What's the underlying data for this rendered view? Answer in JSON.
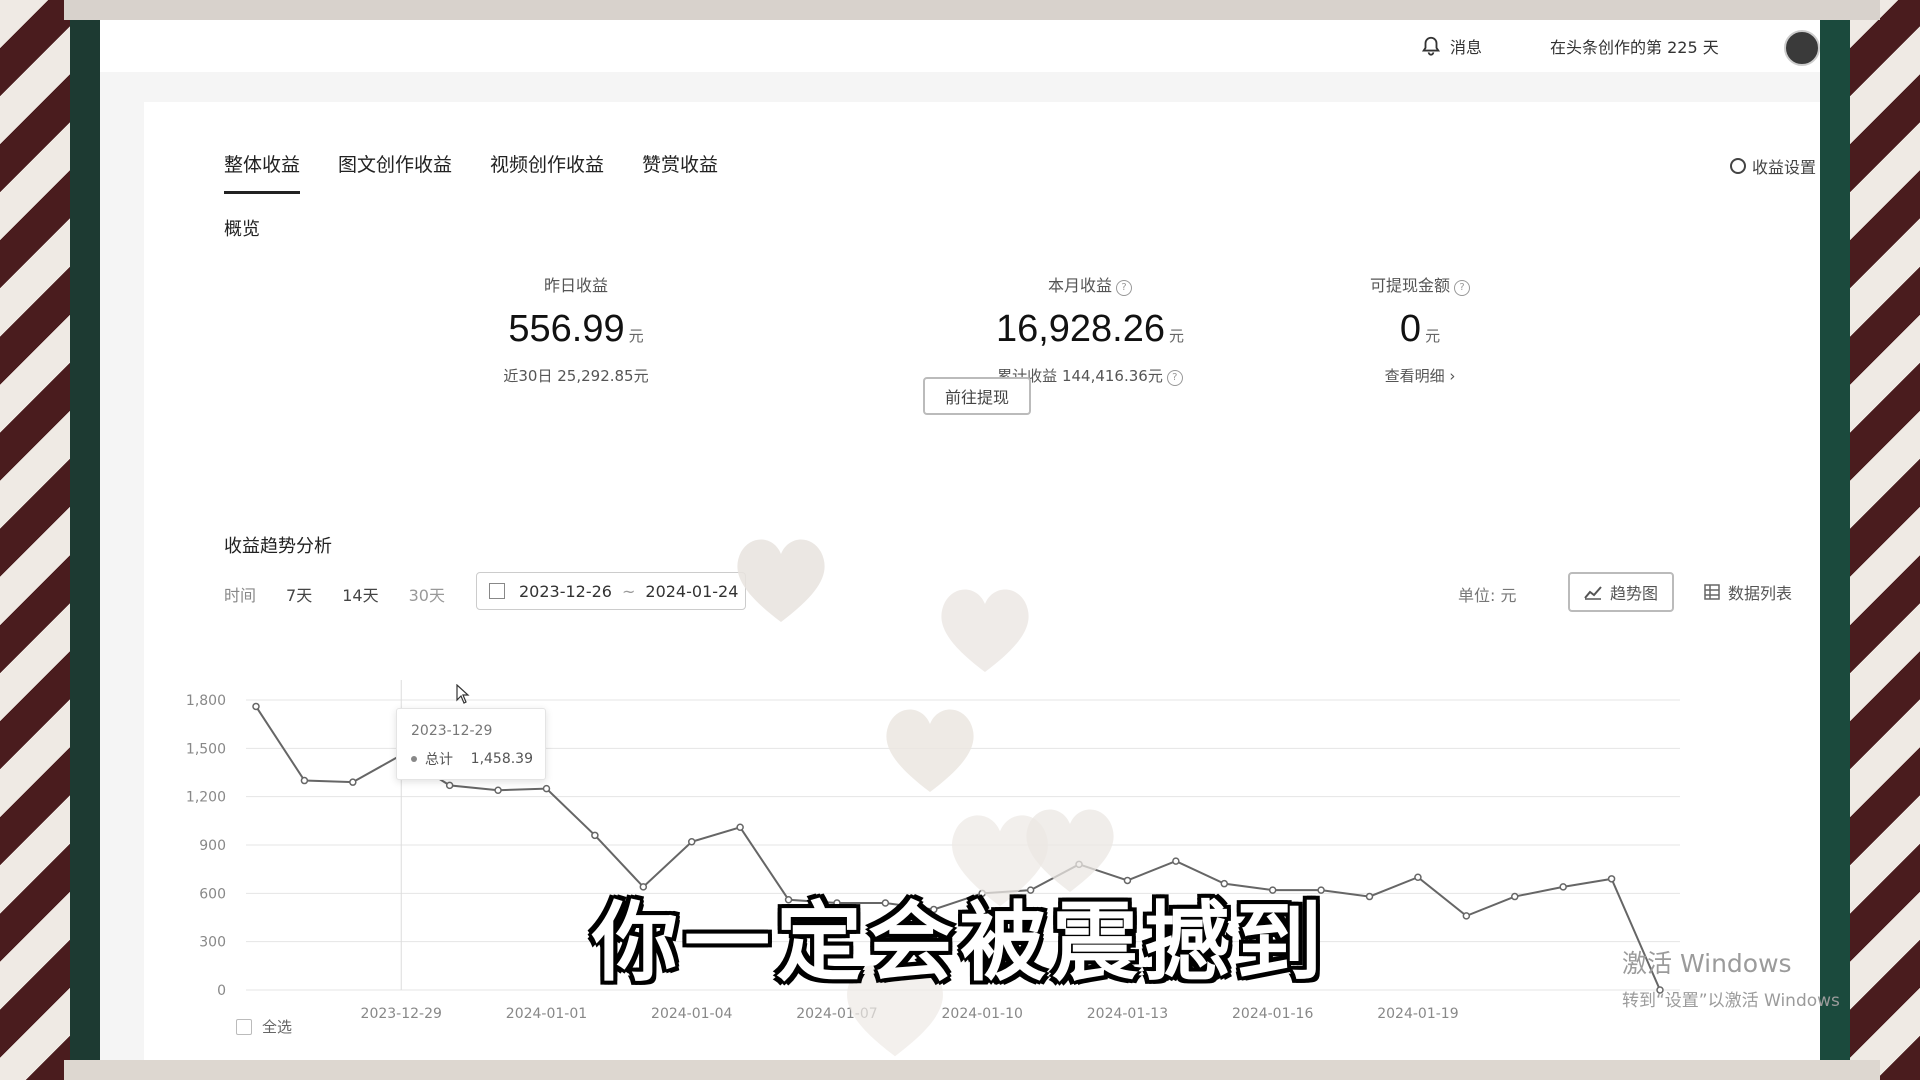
{
  "topbar": {
    "messages_label": "消息",
    "creator_days": "在头条创作的第 225 天"
  },
  "tabs": [
    "整体收益",
    "图文创作收益",
    "视频创作收益",
    "赞赏收益"
  ],
  "settings_label": "收益设置",
  "overview": {
    "title": "概览",
    "yesterday": {
      "label": "昨日收益",
      "value": "556.99",
      "unit": "元",
      "sub": "近30日 25,292.85元"
    },
    "month": {
      "label": "本月收益",
      "value": "16,928.26",
      "unit": "元",
      "sub": "累计收益 144,416.36元"
    },
    "withdrawable": {
      "label": "可提现金额",
      "value": "0",
      "unit": "元",
      "sub": "查看明细 ›"
    },
    "help_glyph": "?",
    "withdraw_button": "前往提现"
  },
  "trend": {
    "title": "收益趋势分析",
    "time_label": "时间",
    "ranges": [
      "7天",
      "14天",
      "30天"
    ],
    "start_date": "2023-12-26",
    "end_date": "2024-01-24",
    "date_separator": "~",
    "unit_label": "单位: 元",
    "view_trend": "趋势图",
    "view_table": "数据列表",
    "select_all": "全选"
  },
  "tooltip": {
    "date": "2023-12-29",
    "series": "总计",
    "value": "1,458.39"
  },
  "chart_data": {
    "type": "line",
    "x": [
      "2023-12-26",
      "2023-12-27",
      "2023-12-28",
      "2023-12-29",
      "2023-12-30",
      "2023-12-31",
      "2024-01-01",
      "2024-01-02",
      "2024-01-03",
      "2024-01-04",
      "2024-01-05",
      "2024-01-06",
      "2024-01-07",
      "2024-01-08",
      "2024-01-09",
      "2024-01-10",
      "2024-01-11",
      "2024-01-12",
      "2024-01-13",
      "2024-01-14",
      "2024-01-15",
      "2024-01-16",
      "2024-01-17",
      "2024-01-18",
      "2024-01-19",
      "2024-01-20",
      "2024-01-21",
      "2024-01-22",
      "2024-01-23",
      "2024-01-24"
    ],
    "series": [
      {
        "name": "总计",
        "values": [
          1760,
          1300,
          1290,
          1458.39,
          1270,
          1240,
          1250,
          960,
          640,
          920,
          1010,
          560,
          540,
          540,
          500,
          600,
          620,
          780,
          680,
          800,
          660,
          620,
          620,
          580,
          700,
          460,
          580,
          640,
          690,
          0
        ]
      }
    ],
    "y_ticks": [
      0,
      300,
      600,
      900,
      1200,
      1500,
      1800
    ],
    "y_tick_labels": [
      "0",
      "300",
      "600",
      "900",
      "1,200",
      "1,500",
      "1,800"
    ],
    "x_tick_labels": [
      "2023-12-29",
      "2024-01-01",
      "2024-01-04",
      "2024-01-07",
      "2024-01-10",
      "2024-01-13",
      "2024-01-16",
      "2024-01-19"
    ],
    "ylim": [
      0,
      1800
    ],
    "grid": true
  },
  "overlay": {
    "subtitle": "你一定会被震撼到",
    "watermark_line1": "激活 Windows",
    "watermark_line2": "转到“设置”以激活 Windows"
  },
  "colors": {
    "line": "#666666",
    "grid": "#e5e5e5",
    "accent": "#222222"
  }
}
